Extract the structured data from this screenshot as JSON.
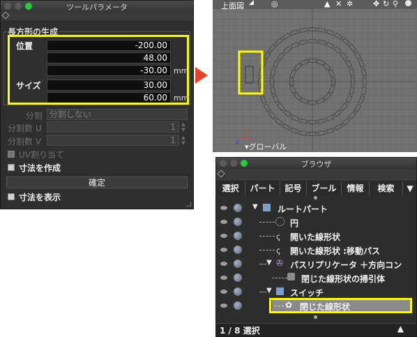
{
  "tool_params": {
    "title": "ツールパラメータ",
    "group_title": "長方形の生成",
    "position_label": "位置",
    "position_values": [
      "-200.00",
      "48.00",
      "-30.00"
    ],
    "position_unit": "mm",
    "size_label": "サイズ",
    "size_values": [
      "30.00",
      "60.00"
    ],
    "size_unit": "mm",
    "split_label": "分割",
    "split_value": "分割しない",
    "split_u_label": "分割数 U",
    "split_u_value": "1",
    "split_v_label": "分割数 V",
    "split_v_value": "1",
    "uv_label": "UV割り当て",
    "create_dim_label": "寸法を作成",
    "confirm_label": "確定",
    "show_dim_label": "寸法を表示"
  },
  "viewport": {
    "view_name": "上面図",
    "global_label": "▾グローバル",
    "axis_z": "z"
  },
  "browser": {
    "title": "ブラウザ",
    "tabs": [
      "選択",
      "パート",
      "記号",
      "ブール",
      "情報",
      "検索"
    ],
    "nodes": [
      {
        "label": "ルートパート",
        "icon": "part-icon"
      },
      {
        "label": "円",
        "icon": "circle-icon"
      },
      {
        "label": "開いた線形状",
        "icon": "open-line-icon"
      },
      {
        "label": "開いた線形状 :移動パス",
        "icon": "open-line-icon"
      },
      {
        "label": "パスリプリケータ ＋方向コン",
        "icon": "path-replicator-icon"
      },
      {
        "label": "閉じた線形状の掃引体",
        "icon": "sweep-icon"
      },
      {
        "label": "スイッチ",
        "icon": "switch-icon"
      },
      {
        "label": "閉じた線形状",
        "icon": "closed-line-icon"
      }
    ],
    "status_text": "1 / 8 選択"
  },
  "colors": {
    "highlight": "#ffff00",
    "arrow": "#e8442a"
  }
}
